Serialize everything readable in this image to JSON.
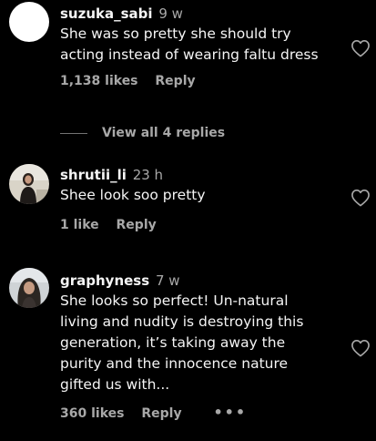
{
  "comments": [
    {
      "username": "suzuka_sabi",
      "time": "9 w",
      "text_lines": [
        "She was so pretty she should try",
        "acting instead of wearing faltu dress"
      ],
      "likes": "1,138 likes",
      "reply": "Reply",
      "view_replies": "View all 4 replies"
    },
    {
      "username": "shrutii_li",
      "time": "23 h",
      "text_lines": [
        "Shee look soo pretty"
      ],
      "likes": "1 like",
      "reply": "Reply"
    },
    {
      "username": "graphyness",
      "time": "7 w",
      "text_lines": [
        "She looks so perfect! Un-natural",
        "living and nudity is destroying this",
        "generation, it’s taking away the",
        "purity and the innocence nature",
        "gifted us with..."
      ],
      "likes": "360 likes",
      "reply": "Reply",
      "more": "•••"
    }
  ],
  "icons": {
    "like": "heart-outline-icon"
  },
  "colors": {
    "background": "#000000",
    "primary_text": "#f5f5f5",
    "secondary_text": "#a8a8a8"
  }
}
